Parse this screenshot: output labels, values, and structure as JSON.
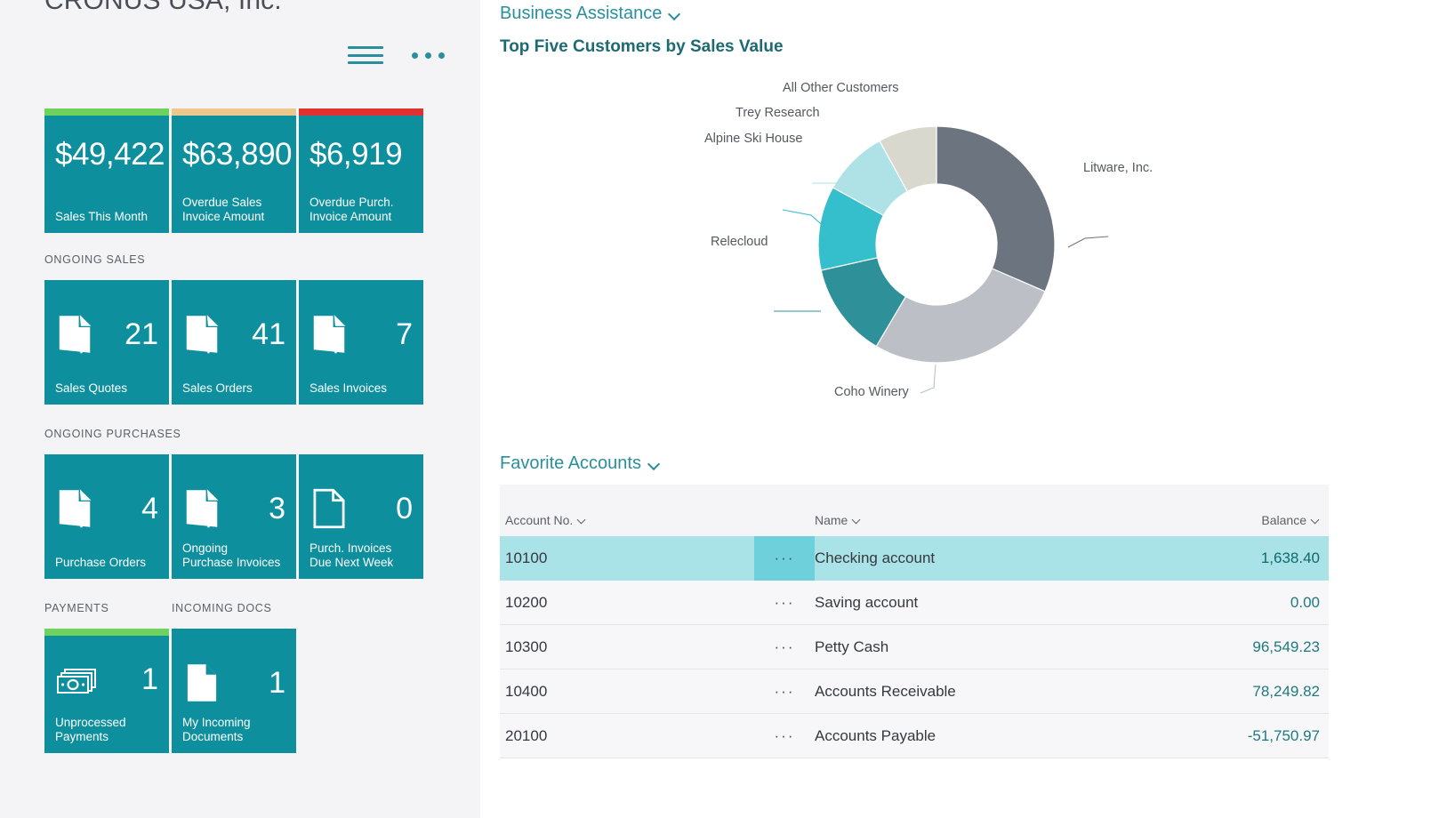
{
  "company": {
    "title": "CRONUS USA, Inc."
  },
  "toolbar": {
    "menu_icon": "hamburger-icon",
    "more_icon": "ellipsis-icon"
  },
  "kpi_tiles": [
    {
      "value": "$49,422",
      "caption": "Sales This Month",
      "accent": "#6dd35c"
    },
    {
      "value": "$63,890",
      "caption": "Overdue Sales\nInvoice Amount",
      "accent": "#ecc88a"
    },
    {
      "value": "$6,919",
      "caption": "Overdue Purch.\nInvoice Amount",
      "accent": "#e03030"
    }
  ],
  "groups": [
    {
      "label": "ONGOING SALES",
      "tiles": [
        {
          "count": "21",
          "caption": "Sales Quotes",
          "icon": "document-filled-icon"
        },
        {
          "count": "41",
          "caption": "Sales Orders",
          "icon": "document-filled-icon"
        },
        {
          "count": "7",
          "caption": "Sales Invoices",
          "icon": "document-filled-icon"
        }
      ]
    },
    {
      "label": "ONGOING PURCHASES",
      "tiles": [
        {
          "count": "4",
          "caption": "Purchase Orders",
          "icon": "document-filled-icon"
        },
        {
          "count": "3",
          "caption": "Ongoing\nPurchase Invoices",
          "icon": "document-filled-icon"
        },
        {
          "count": "0",
          "caption": "Purch. Invoices\nDue Next Week",
          "icon": "document-outline-icon"
        }
      ]
    },
    {
      "label": "PAYMENTS",
      "tiles": [
        {
          "count": "1",
          "caption": "Unprocessed\nPayments",
          "icon": "banknote-icon",
          "accent": "#6dd35c"
        }
      ]
    },
    {
      "label": "INCOMING DOCS",
      "tiles": [
        {
          "count": "1",
          "caption": "My Incoming\nDocuments",
          "icon": "page-folded-icon"
        }
      ]
    }
  ],
  "business_assistance": {
    "label": "Business Assistance"
  },
  "chart_data": {
    "type": "pie",
    "title": "Top Five Customers by Sales Value",
    "donut": true,
    "legend_position": "callout-labels",
    "categories": [
      "Litware, Inc.",
      "Coho Winery",
      "Relecloud",
      "Alpine Ski House",
      "Trey Research",
      "All Other Customers"
    ],
    "values": [
      31.5,
      27.0,
      13.0,
      11.5,
      9.0,
      8.0
    ],
    "colors": [
      "#6b747f",
      "#bcc0c6",
      "#2e9199",
      "#35becb",
      "#aee2e6",
      "#d8d8cf"
    ],
    "xlabel": "",
    "ylabel": ""
  },
  "favorite_accounts": {
    "label": "Favorite Accounts",
    "columns": [
      {
        "label": "Account No."
      },
      {
        "label": ""
      },
      {
        "label": "Name"
      },
      {
        "label": "Balance"
      }
    ],
    "row_menu_icon": "ellipsis-icon",
    "rows": [
      {
        "account_no": "10100",
        "name": "Checking account",
        "balance": "1,638.40",
        "selected": true
      },
      {
        "account_no": "10200",
        "name": "Saving account",
        "balance": "0.00",
        "selected": false
      },
      {
        "account_no": "10300",
        "name": "Petty Cash",
        "balance": "96,549.23",
        "selected": false
      },
      {
        "account_no": "10400",
        "name": "Accounts Receivable",
        "balance": "78,249.82",
        "selected": false
      },
      {
        "account_no": "20100",
        "name": "Accounts Payable",
        "balance": "-51,750.97",
        "selected": false
      }
    ]
  }
}
